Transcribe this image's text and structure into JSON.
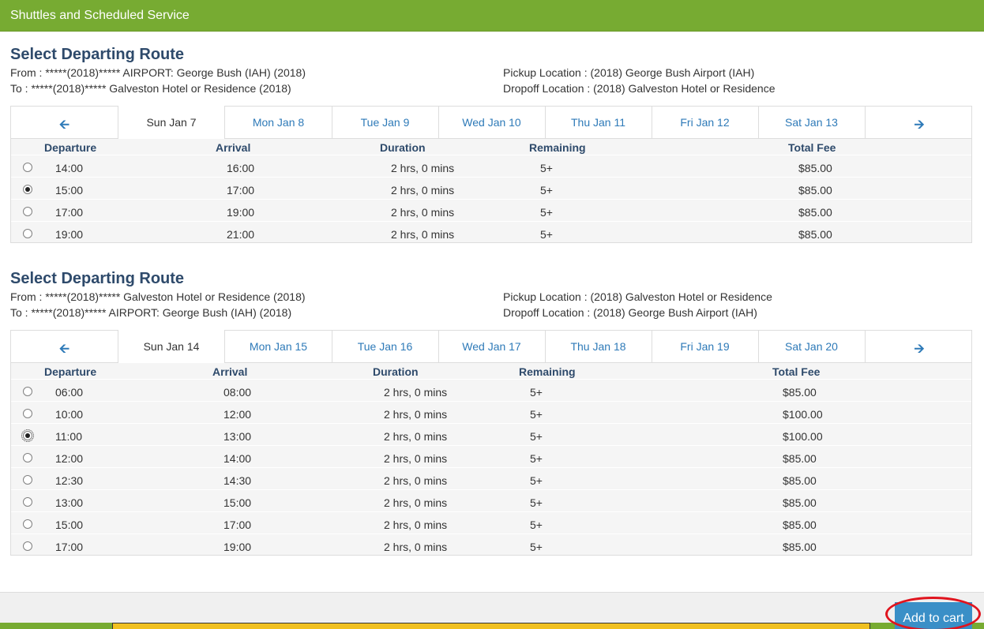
{
  "header": {
    "title": "Shuttles and Scheduled Service"
  },
  "routes": [
    {
      "title": "Select Departing Route",
      "from": "From : *****(2018)***** AIRPORT: George Bush (IAH) (2018)",
      "to": "To : *****(2018)***** Galveston Hotel or Residence (2018)",
      "pickup": "Pickup Location : (2018) George Bush Airport (IAH)",
      "dropoff": "Dropoff Location : (2018) Galveston Hotel or Residence",
      "tabs": [
        "Sun Jan 7",
        "Mon Jan 8",
        "Tue Jan 9",
        "Wed Jan 10",
        "Thu Jan 11",
        "Fri Jan 12",
        "Sat Jan 13"
      ],
      "columns": {
        "departure": "Departure",
        "arrival": "Arrival",
        "duration": "Duration",
        "remaining": "Remaining",
        "fee": "Total Fee"
      },
      "rows": [
        {
          "departure": "14:00",
          "arrival": "16:00",
          "duration": "2 hrs, 0 mins",
          "remaining": "5+",
          "fee": "$85.00"
        },
        {
          "departure": "15:00",
          "arrival": "17:00",
          "duration": "2 hrs, 0 mins",
          "remaining": "5+",
          "fee": "$85.00"
        },
        {
          "departure": "17:00",
          "arrival": "19:00",
          "duration": "2 hrs, 0 mins",
          "remaining": "5+",
          "fee": "$85.00"
        },
        {
          "departure": "19:00",
          "arrival": "21:00",
          "duration": "2 hrs, 0 mins",
          "remaining": "5+",
          "fee": "$85.00"
        }
      ]
    },
    {
      "title": "Select Departing Route",
      "from": "From : *****(2018)***** Galveston Hotel or Residence (2018)",
      "to": "To : *****(2018)***** AIRPORT: George Bush (IAH) (2018)",
      "pickup": "Pickup Location : (2018) Galveston Hotel or Residence",
      "dropoff": "Dropoff Location : (2018) George Bush Airport (IAH)",
      "tabs": [
        "Sun Jan 14",
        "Mon Jan 15",
        "Tue Jan 16",
        "Wed Jan 17",
        "Thu Jan 18",
        "Fri Jan 19",
        "Sat Jan 20"
      ],
      "columns": {
        "departure": "Departure",
        "arrival": "Arrival",
        "duration": "Duration",
        "remaining": "Remaining",
        "fee": "Total Fee"
      },
      "rows": [
        {
          "departure": "06:00",
          "arrival": "08:00",
          "duration": "2 hrs, 0 mins",
          "remaining": "5+",
          "fee": "$85.00"
        },
        {
          "departure": "10:00",
          "arrival": "12:00",
          "duration": "2 hrs, 0 mins",
          "remaining": "5+",
          "fee": "$100.00"
        },
        {
          "departure": "11:00",
          "arrival": "13:00",
          "duration": "2 hrs, 0 mins",
          "remaining": "5+",
          "fee": "$100.00"
        },
        {
          "departure": "12:00",
          "arrival": "14:00",
          "duration": "2 hrs, 0 mins",
          "remaining": "5+",
          "fee": "$85.00"
        },
        {
          "departure": "12:30",
          "arrival": "14:30",
          "duration": "2 hrs, 0 mins",
          "remaining": "5+",
          "fee": "$85.00"
        },
        {
          "departure": "13:00",
          "arrival": "15:00",
          "duration": "2 hrs, 0 mins",
          "remaining": "5+",
          "fee": "$85.00"
        },
        {
          "departure": "15:00",
          "arrival": "17:00",
          "duration": "2 hrs, 0 mins",
          "remaining": "5+",
          "fee": "$85.00"
        },
        {
          "departure": "17:00",
          "arrival": "19:00",
          "duration": "2 hrs, 0 mins",
          "remaining": "5+",
          "fee": "$85.00"
        }
      ]
    }
  ],
  "icons": {
    "prev": "arrow-left-icon",
    "next": "arrow-right-icon"
  },
  "footer": {
    "add_to_cart": "Add to cart"
  },
  "colors": {
    "header_green": "#77ab32",
    "link_blue": "#2e7ab8",
    "title_navy": "#2e4a6b",
    "button_blue": "#3a8fc7",
    "highlight_red": "#e0141e"
  }
}
